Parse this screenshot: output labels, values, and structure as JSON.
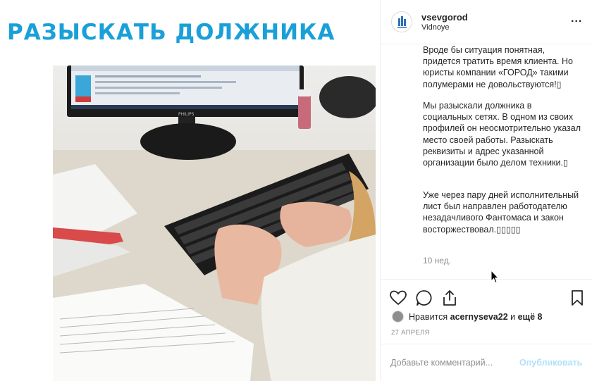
{
  "media": {
    "headline": "РАЗЫСКАТЬ ДОЛЖНИКА",
    "monitor_brand": "PHILIPS"
  },
  "post": {
    "username": "vsevgorod",
    "location": "Vidnoye",
    "more_label": "...",
    "caption_paragraphs": [
      "Вроде бы ситуация понятная, придется тратить время клиента. Но юристы компании «ГОРОД» такими полумерами не довольствуются!▯",
      "Мы разыскали должника в социальных сетях. В одном из своих профилей он неосмотрительно указал место своей работы. Разыскать реквизиты и адрес указанной организации было делом техники.▯",
      "Уже через пару дней исполнительный лист был направлен работодателю незадачливого Фантомаса и закон восторжествовал.▯▯▯▯▯"
    ],
    "comment_time": "10 нед."
  },
  "actions": {
    "like_icon": "heart-icon",
    "comment_icon": "speech-bubble-icon",
    "share_icon": "share-icon",
    "save_icon": "bookmark-icon",
    "likes_prefix": "Нравится ",
    "likes_user": "acernyseva22",
    "likes_middle": " и ",
    "likes_more": "ещё 8",
    "date": "27 АПРЕЛЯ"
  },
  "comment_box": {
    "placeholder": "Добавьте комментарий...",
    "value": "",
    "publish_label": "Опубликовать"
  },
  "colors": {
    "headline": "#1aa0d8",
    "text": "#262626",
    "muted": "#8e8e8e",
    "publish_disabled": "#b2dffc",
    "border": "#efefef"
  }
}
